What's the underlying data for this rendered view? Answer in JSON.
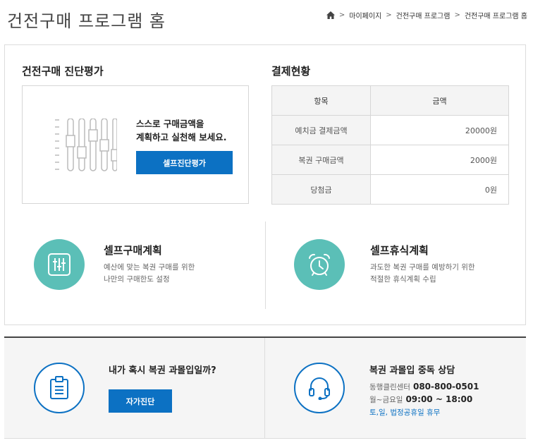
{
  "page": {
    "title": "건전구매 프로그램 홈"
  },
  "breadcrumb": {
    "items": [
      "마이페이지",
      "건전구매 프로그램",
      "건전구매 프로그램 홈"
    ],
    "separator": ">"
  },
  "diagnosis": {
    "title": "건전구매 진단평가",
    "text_line1": "스스로 구매금액을",
    "text_line2": "계획하고 실천해 보세요.",
    "button_label": "셀프진단평가"
  },
  "payment": {
    "title": "결제현황",
    "headers": [
      "항목",
      "금액"
    ],
    "rows": [
      {
        "label": "예치금 결제금액",
        "value": "20000원"
      },
      {
        "label": "복권 구매금액",
        "value": "2000원"
      },
      {
        "label": "당첨금",
        "value": "0원"
      }
    ]
  },
  "self_purchase": {
    "title": "셀프구매계획",
    "desc_line1": "예산에 맞는 복권 구매를 위한",
    "desc_line2": "나만의 구매한도 설정"
  },
  "self_rest": {
    "title": "셀프휴식계획",
    "desc_line1": "과도한 복권 구매를 예방하기 위한",
    "desc_line2": "적절한 휴식계획 수립"
  },
  "addiction_check": {
    "title": "내가 혹시 복권 과몰입일까?",
    "button_label": "자가진단"
  },
  "consult": {
    "title": "복권 과몰입 중독 상담",
    "center_label": "동행클린센터",
    "phone": "080-800-0501",
    "hours_label": "월~금요일",
    "hours": "09:00 ~ 18:00",
    "note": "토,일, 법정공휴일 휴무"
  },
  "colors": {
    "primary": "#0c71c3",
    "teal": "#5bbfb7",
    "border": "#dcdcdc",
    "header_bg": "#f4f4f4"
  },
  "icons": [
    "home-icon",
    "sliders-icon",
    "equalizer-icon",
    "alarm-clock-icon",
    "clipboard-icon",
    "headset-icon"
  ]
}
